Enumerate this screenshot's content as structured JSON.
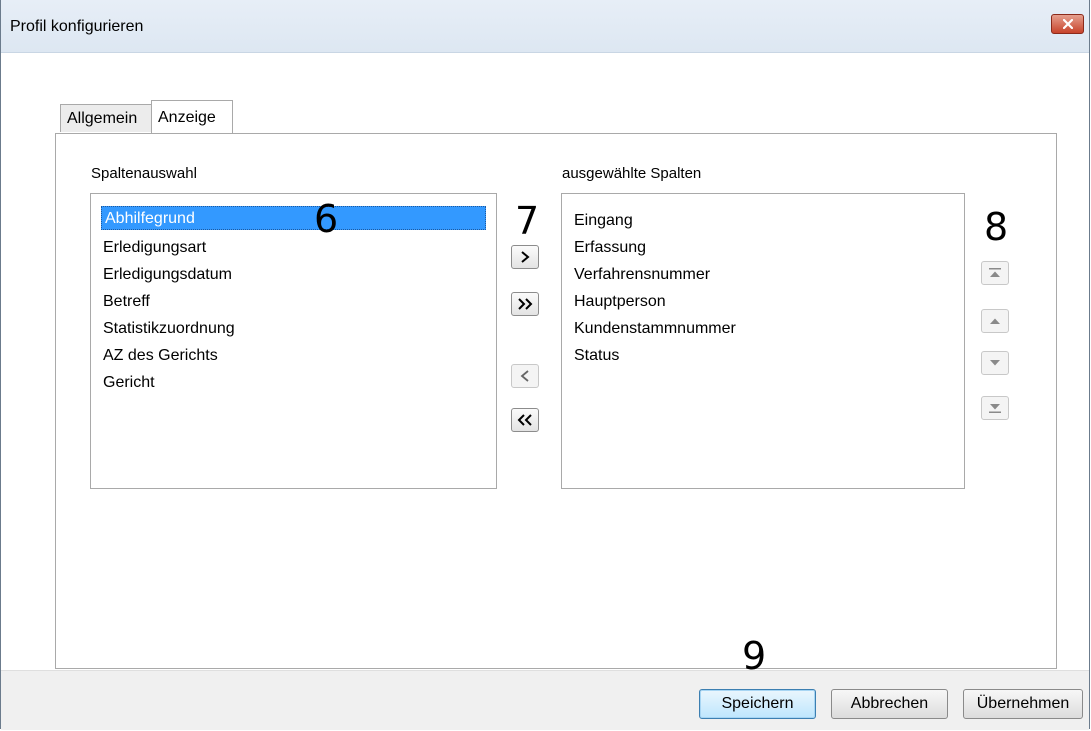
{
  "window": {
    "title": "Profil konfigurieren"
  },
  "tabs": [
    {
      "label": "Allgemein",
      "active": false
    },
    {
      "label": "Anzeige",
      "active": true
    }
  ],
  "available": {
    "label": "Spaltenauswahl",
    "items": [
      "Abhilfegrund",
      "Erledigungsart",
      "Erledigungsdatum",
      "Betreff",
      "Statistikzuordnung",
      "AZ des Gerichts",
      "Gericht"
    ],
    "selected": "Abhilfegrund"
  },
  "selected_columns": {
    "label": "ausgewählte Spalten",
    "items": [
      "Eingang",
      "Erfassung",
      "Verfahrensnummer",
      "Hauptperson",
      "Kundenstammnummer",
      "Status"
    ]
  },
  "transfer_buttons": {
    "add": ">",
    "add_all": ">>",
    "remove": "<",
    "remove_all": "<<"
  },
  "annotations": {
    "n6": "6",
    "n7": "7",
    "n8": "8",
    "n9": "9"
  },
  "footer": {
    "save": "Speichern",
    "cancel": "Abbrechen",
    "apply": "Übernehmen"
  },
  "colors": {
    "selection": "#3399ff",
    "close_button": "#c7432b"
  }
}
